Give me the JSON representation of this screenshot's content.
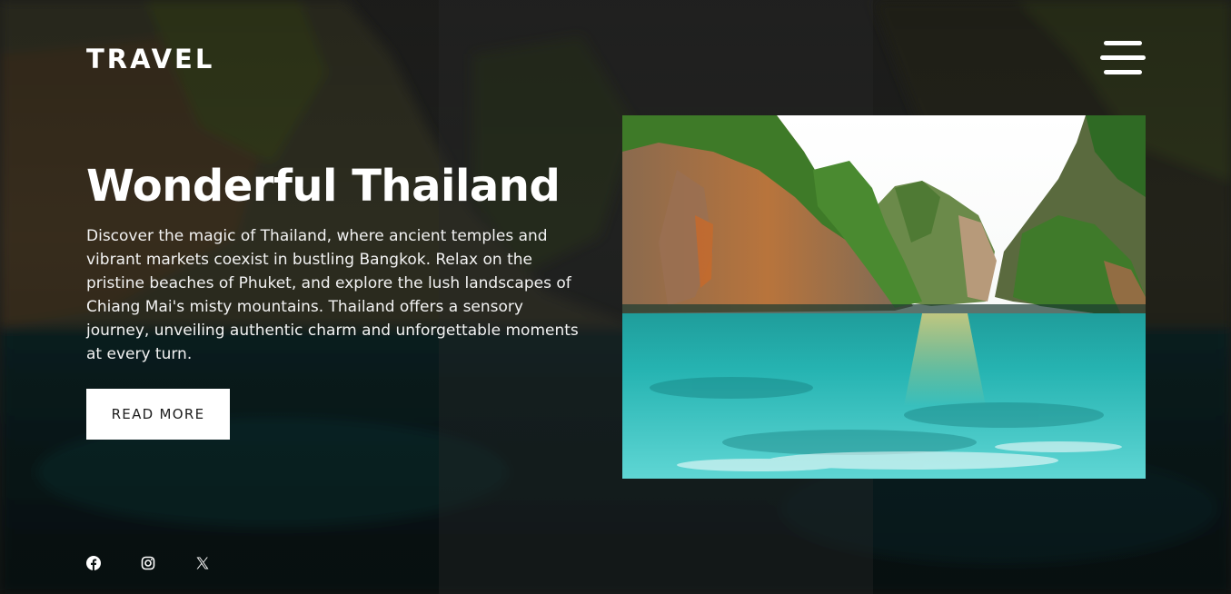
{
  "brand": {
    "logo_text": "TRAVEL"
  },
  "header": {
    "menu_icon": "hamburger-menu-icon"
  },
  "hero": {
    "title": "Wonderful Thailand",
    "description": "Discover the magic of Thailand, where ancient temples and vibrant markets coexist in bustling Bangkok. Relax on the pristine beaches of Phuket, and explore the lush landscapes of Chiang Mai's misty mountains. Thailand offers a sensory journey, unveiling authentic charm and unforgettable moments at every turn.",
    "cta_label": "READ MORE"
  },
  "social": {
    "icons": [
      "facebook-icon",
      "instagram-icon",
      "x-twitter-icon"
    ]
  },
  "colors": {
    "text": "#ffffff",
    "button_bg": "#ffffff",
    "button_text": "#1c1c1c",
    "lagoon": "#2fc3c0",
    "cliff_green": "#3f7a2a"
  }
}
